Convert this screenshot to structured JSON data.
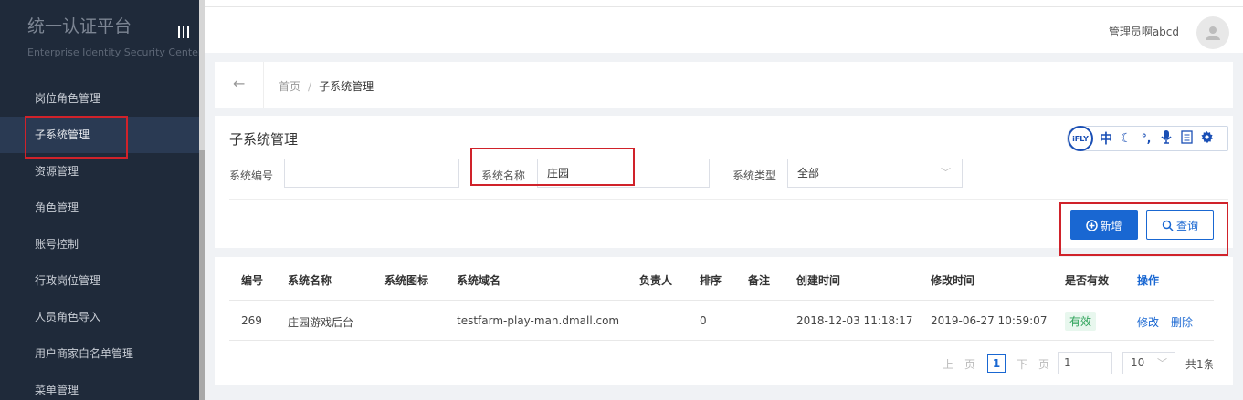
{
  "sidebar": {
    "brand_title": "统一认证平台",
    "brand_subtitle": "Enterprise Identity Security Center",
    "items": [
      {
        "label": "岗位角色管理"
      },
      {
        "label": "子系统管理"
      },
      {
        "label": "资源管理"
      },
      {
        "label": "角色管理"
      },
      {
        "label": "账号控制"
      },
      {
        "label": "行政岗位管理"
      },
      {
        "label": "人员角色导入"
      },
      {
        "label": "用户商家白名单管理"
      },
      {
        "label": "菜单管理"
      }
    ]
  },
  "header": {
    "username": "管理员啊abcd"
  },
  "breadcrumb": {
    "home": "首页",
    "separator": "/",
    "current": "子系统管理"
  },
  "panel": {
    "title": "子系统管理",
    "fields": {
      "code_label": "系统编号",
      "code_value": "",
      "name_label": "系统名称",
      "name_value": "庄园",
      "type_label": "系统类型",
      "type_value": "全部"
    },
    "add_label": "新增",
    "query_label": "查询"
  },
  "ifly": {
    "logo": "iFLY",
    "items": [
      {
        "icon": "chinese-char-icon",
        "glyph": "中"
      },
      {
        "icon": "moon-icon",
        "glyph": "☾"
      },
      {
        "icon": "punctuation-icon",
        "glyph": "°,"
      },
      {
        "icon": "microphone-icon",
        "glyph": "🎙"
      },
      {
        "icon": "document-icon",
        "glyph": "▤"
      },
      {
        "icon": "gear-icon",
        "glyph": "✿"
      }
    ]
  },
  "table": {
    "headers": [
      "编号",
      "系统名称",
      "系统图标",
      "系统域名",
      "负责人",
      "排序",
      "备注",
      "创建时间",
      "修改时间",
      "是否有效",
      "操作"
    ],
    "rows": [
      {
        "id": "269",
        "name": "庄园游戏后台",
        "icon": "",
        "domain": "testfarm-play-man.dmall.com",
        "owner": "",
        "sort": "0",
        "remark": "",
        "created": "2018-12-03 11:18:17",
        "modified": "2019-06-27 10:59:07",
        "status": "有效",
        "edit": "修改",
        "delete": "删除"
      }
    ]
  },
  "pagination": {
    "prev": "上一页",
    "current_page": "1",
    "next": "下一页",
    "jump_value": "1",
    "page_size": "10",
    "total": "共1条"
  },
  "colors": {
    "sidebar_bg": "#1f2a3a",
    "primary": "#1967d2",
    "highlight_box": "#d0222a",
    "status_green": "#2fa35a"
  }
}
